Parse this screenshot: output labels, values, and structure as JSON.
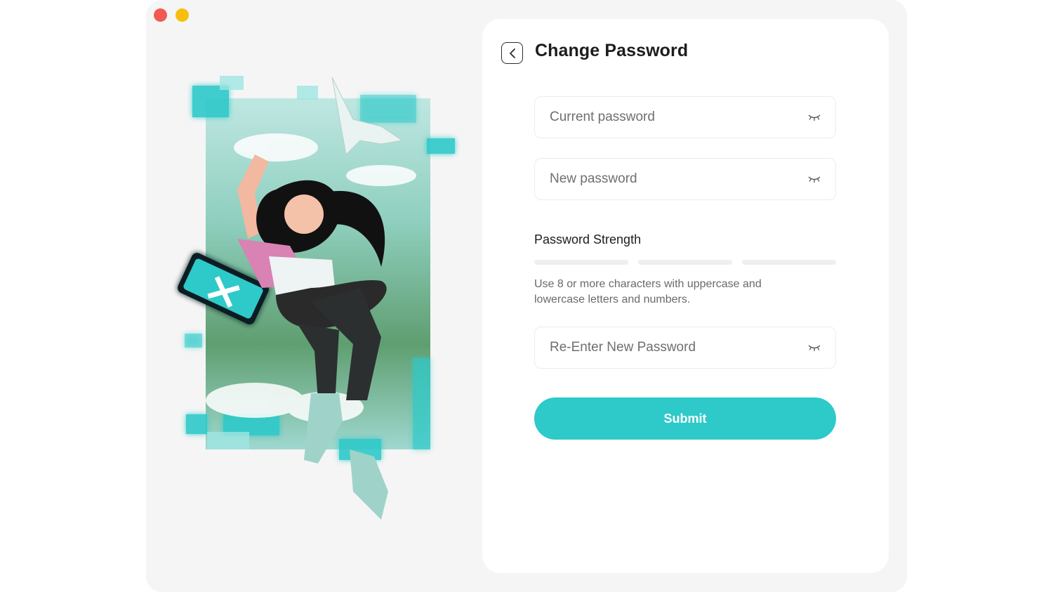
{
  "window": {
    "controls": [
      "close",
      "minimize"
    ]
  },
  "colors": {
    "accent": "#2ec9c9",
    "close": "#f05a52",
    "minimize": "#f6bf10",
    "window_bg": "#f5f5f5",
    "card_bg": "#ffffff"
  },
  "header": {
    "back_icon": "chevron-left-icon",
    "title": "Change Password"
  },
  "form": {
    "current_password": {
      "placeholder": "Current password",
      "value": "",
      "icon": "eye-closed-icon"
    },
    "new_password": {
      "placeholder": "New password",
      "value": "",
      "icon": "eye-closed-icon"
    },
    "strength": {
      "label": "Password Strength",
      "level": 0,
      "segments": 3,
      "hint": "Use 8 or more characters with uppercase and lowercase letters and numbers."
    },
    "confirm_password": {
      "placeholder": "Re-Enter New Password",
      "value": "",
      "icon": "eye-closed-icon"
    },
    "submit_label": "Submit"
  }
}
